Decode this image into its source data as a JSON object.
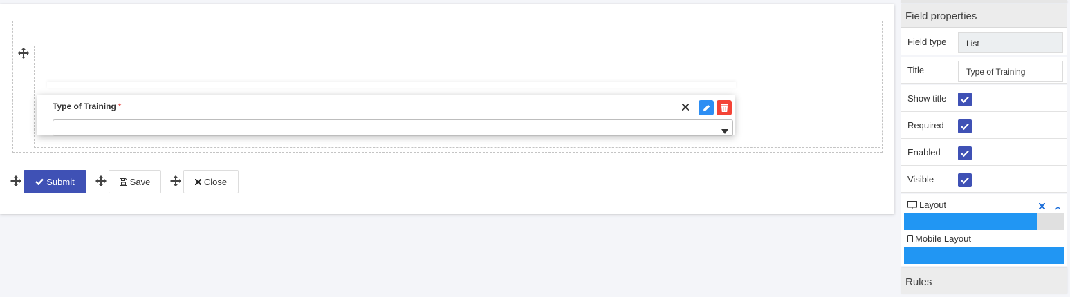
{
  "form": {
    "field": {
      "label": "Type of Training",
      "required_marker": "*",
      "select_value": ""
    },
    "buttons": {
      "submit_label": "Submit",
      "save_label": "Save",
      "close_label": "Close"
    }
  },
  "panel": {
    "title": "Field properties",
    "properties": {
      "field_type": {
        "label": "Field type",
        "value": "List"
      },
      "title": {
        "label": "Title",
        "value": "Type of Training"
      },
      "show_title": {
        "label": "Show title",
        "checked": true
      },
      "required": {
        "label": "Required",
        "checked": true
      },
      "enabled": {
        "label": "Enabled",
        "checked": true
      },
      "visible": {
        "label": "Visible",
        "checked": true
      }
    },
    "layout": {
      "label": "Layout",
      "fill_percent": 83
    },
    "mobile_layout": {
      "label": "Mobile Layout",
      "fill_percent": 100
    },
    "rules_title": "Rules"
  },
  "colors": {
    "primary": "#3f51b5",
    "edit": "#2d8ef3",
    "delete": "#f44336",
    "layout_fill": "#2196f3"
  },
  "icons": {
    "drag": "move-arrows-icon",
    "close": "close-icon",
    "edit": "pencil-icon",
    "delete": "trash-icon",
    "caret": "caret-down-icon",
    "check": "check-icon",
    "save": "floppy-disk-icon",
    "desktop": "desktop-icon",
    "mobile": "mobile-icon",
    "collapse": "chevron-up-icon"
  }
}
